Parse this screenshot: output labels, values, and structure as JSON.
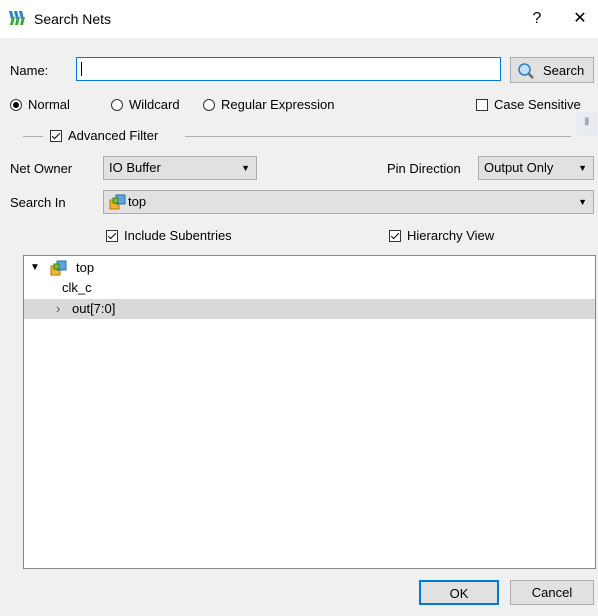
{
  "window": {
    "title": "Search Nets",
    "help_label": "?",
    "close_label": "✕"
  },
  "name_row": {
    "label": "Name:",
    "value": "",
    "search_button_label": "Search"
  },
  "mode": {
    "options": [
      "Normal",
      "Wildcard",
      "Regular Expression"
    ],
    "selected": "Normal",
    "case_sensitive_label": "Case Sensitive",
    "case_sensitive_checked": false
  },
  "advanced_filter": {
    "label": "Advanced Filter",
    "checked": true
  },
  "net_owner": {
    "label": "Net Owner",
    "value": "IO Buffer"
  },
  "pin_direction": {
    "label": "Pin Direction",
    "value": "Output Only"
  },
  "search_in": {
    "label": "Search In",
    "value": "top"
  },
  "options": {
    "include_subentries_label": "Include Subentries",
    "include_subentries_checked": true,
    "hierarchy_view_label": "Hierarchy View",
    "hierarchy_view_checked": true
  },
  "tree": {
    "root": "top",
    "items": [
      {
        "label": "clk_c",
        "expandable": false
      },
      {
        "label": "out[7:0]",
        "expandable": true
      }
    ]
  },
  "footer": {
    "ok_label": "OK",
    "cancel_label": "Cancel"
  },
  "colors": {
    "selection": "#d9d9d9",
    "accent": "#0078d7"
  }
}
